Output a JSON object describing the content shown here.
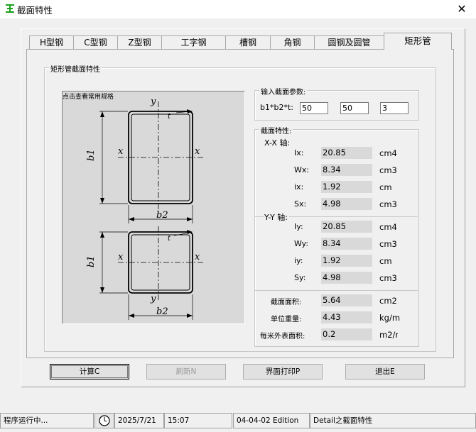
{
  "window": {
    "title": "截面特性",
    "close": "✕"
  },
  "tabs": [
    {
      "label": "H型钢"
    },
    {
      "label": "C型钢"
    },
    {
      "label": "Z型钢"
    },
    {
      "label": "工字钢"
    },
    {
      "label": "槽钢"
    },
    {
      "label": "角钢"
    },
    {
      "label": "圆钢及圆管"
    },
    {
      "label": "矩形管"
    }
  ],
  "active_tab": "矩形管",
  "panel": {
    "group_title": "矩形管截面特性",
    "image_label": "点击查看常用规格",
    "diagram": {
      "y": "y",
      "x": "x",
      "t": "t",
      "b1": "b1",
      "b2": "b2"
    }
  },
  "params": {
    "title": "输入截面参数:",
    "label": "b1*b2*t:",
    "values": [
      "50",
      "50",
      "3"
    ]
  },
  "props": {
    "title": "截面特性:",
    "xx_title": "X-X 轴:",
    "yy_title": "Y-Y 轴:",
    "xx": [
      {
        "label": "Ix:",
        "value": "20.85",
        "unit": "cm4"
      },
      {
        "label": "Wx:",
        "value": "8.34",
        "unit": "cm3"
      },
      {
        "label": "ix:",
        "value": "1.92",
        "unit": "cm"
      },
      {
        "label": "Sx:",
        "value": "4.98",
        "unit": "cm3"
      }
    ],
    "yy": [
      {
        "label": "Iy:",
        "value": "20.85",
        "unit": "cm4"
      },
      {
        "label": "Wy:",
        "value": "8.34",
        "unit": "cm3"
      },
      {
        "label": "iy:",
        "value": "1.92",
        "unit": "cm"
      },
      {
        "label": "Sy:",
        "value": "4.98",
        "unit": "cm3"
      }
    ],
    "other": [
      {
        "label": "截面面积:",
        "value": "5.64",
        "unit": "cm2"
      },
      {
        "label": "单位重量:",
        "value": "4.43",
        "unit": "kg/m"
      },
      {
        "label": "每米外表面积:",
        "value": "0.2",
        "unit": "m2/m"
      }
    ]
  },
  "buttons": {
    "calc": "计算C",
    "refresh": "刷新N",
    "print": "界面打印P",
    "exit": "退出E"
  },
  "statusbar": {
    "status": "程序运行中...",
    "date": "2025/7/21",
    "time": "15:07",
    "version": "04-04-02 Edition",
    "detail": "Detail之截面特性"
  }
}
